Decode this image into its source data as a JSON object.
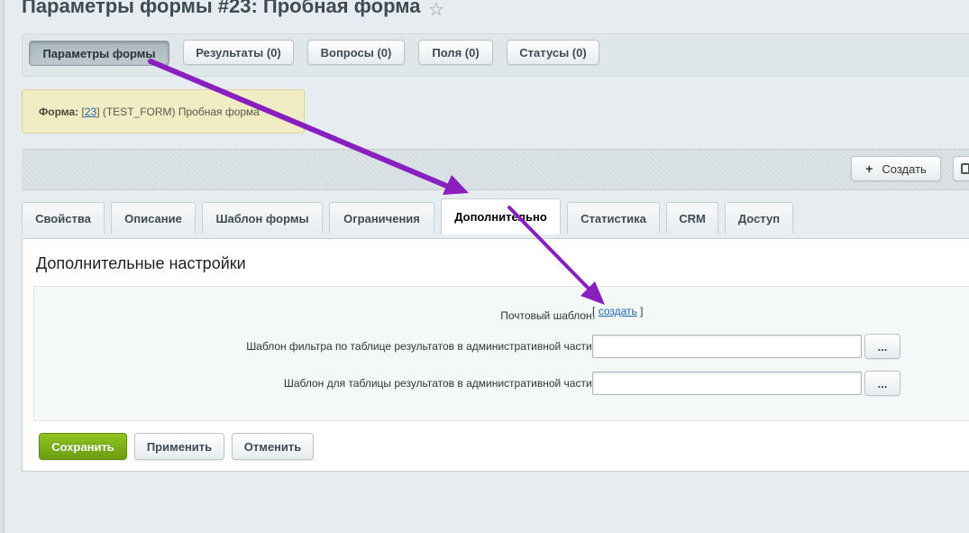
{
  "page": {
    "title": "Параметры формы #23: Пробная форма",
    "favorite_icon": "star-icon"
  },
  "top_tabs": [
    {
      "label": "Параметры формы",
      "active": true
    },
    {
      "label": "Результаты (0)"
    },
    {
      "label": "Вопросы (0)"
    },
    {
      "label": "Поля (0)"
    },
    {
      "label": "Статусы (0)"
    }
  ],
  "form_info": {
    "label": "Форма:",
    "id_prefix": "[",
    "id": "23",
    "rest": "] (TEST_FORM) Пробная форма"
  },
  "toolbar": {
    "create_label": "Создать",
    "create_icon": "plus-icon"
  },
  "tabs": [
    {
      "label": "Свойства"
    },
    {
      "label": "Описание"
    },
    {
      "label": "Шаблон формы"
    },
    {
      "label": "Ограничения"
    },
    {
      "label": "Дополнительно",
      "active": true
    },
    {
      "label": "Статистика"
    },
    {
      "label": "CRM"
    },
    {
      "label": "Доступ"
    }
  ],
  "panel": {
    "title": "Дополнительные настройки",
    "mail_template_label": "Почтовый шаблон:",
    "mail_template_open": "[",
    "mail_template_link": "создать",
    "mail_template_close": "]",
    "filter_template_label": "Шаблон фильтра по таблице результатов в административной части:",
    "filter_template_value": "",
    "table_template_label": "Шаблон для таблицы результатов в административной части:",
    "table_template_value": "",
    "browse_label": "..."
  },
  "actions": {
    "save": "Сохранить",
    "apply": "Применить",
    "cancel": "Отменить"
  },
  "colors": {
    "annotation_arrow": "#8a1fbf",
    "save_button": "#7cb518",
    "link": "#2067b0"
  }
}
